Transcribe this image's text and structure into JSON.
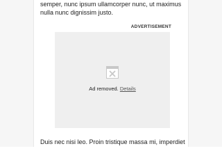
{
  "article": {
    "paragraph_top": "semper, nunc ipsum ullamcorper nunc, ut maximus nulla nunc dignissim justo.",
    "paragraph_bottom": "Duis nec nisi leo. Proin tristique massa mi, imperdiet"
  },
  "ad": {
    "label": "ADVERTISEMENT",
    "removed_text": "Ad removed.",
    "details_link": "Details",
    "icon": "broken-image-icon"
  },
  "colors": {
    "ad_background": "#efefef",
    "text": "#222222",
    "icon": "#c8c8c8"
  }
}
